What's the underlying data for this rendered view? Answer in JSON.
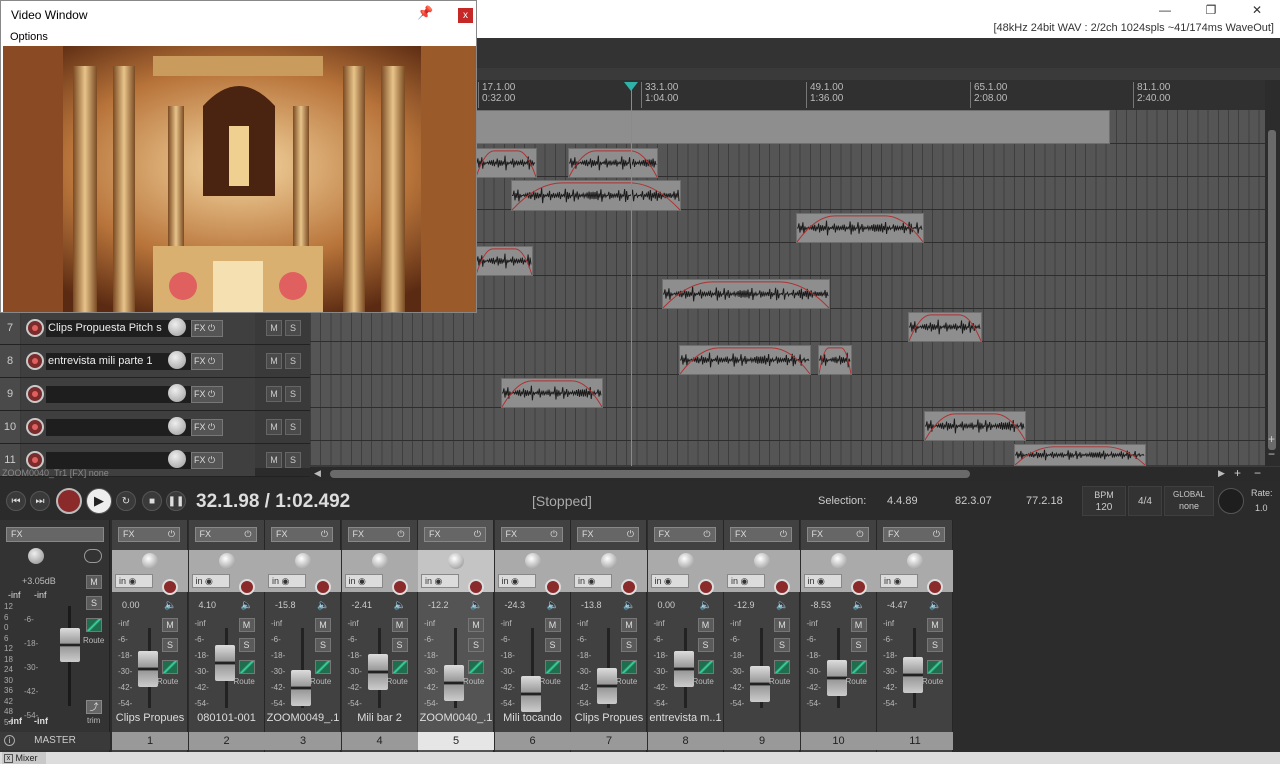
{
  "window": {
    "status_info": "[48kHz 24bit WAV : 2/2ch 1024spls ~41/174ms WaveOut]"
  },
  "video_window": {
    "title": "Video Window",
    "menu": "Options",
    "close": "x"
  },
  "ruler": [
    {
      "bar": "17.1.00",
      "time": "0:32.00"
    },
    {
      "bar": "33.1.00",
      "time": "1:04.00"
    },
    {
      "bar": "49.1.00",
      "time": "1:36.00"
    },
    {
      "bar": "65.1.00",
      "time": "2:08.00"
    },
    {
      "bar": "81.1.00",
      "time": "2:40.00"
    }
  ],
  "tracks": [
    {
      "num": "7",
      "name": "Clips   Propuesta   Pitch s"
    },
    {
      "num": "8",
      "name": "entrevista mili parte 1"
    },
    {
      "num": "9",
      "name": ""
    },
    {
      "num": "10",
      "name": ""
    },
    {
      "num": "11",
      "name": ""
    }
  ],
  "track_controls": {
    "fx": "FX",
    "mute": "M",
    "solo": "S"
  },
  "selected_item_info": "ZOOM0040_Tr1 [FX] none",
  "transport": {
    "timecode": "32.1.98 / 1:02.492",
    "state": "[Stopped]",
    "selection_label": "Selection:",
    "selection_start": "4.4.89",
    "selection_end": "82.3.07",
    "selection_length": "77.2.18",
    "bpm_label": "BPM",
    "bpm": "120",
    "time_sig": "4/4",
    "global_label": "GLOBAL",
    "global_value": "none",
    "rate_label": "Rate:",
    "rate": "1.0"
  },
  "master": {
    "gain": "+3.05dB",
    "peak_l": "-inf",
    "peak_r": "-inf",
    "scale_left": [
      "12",
      "6",
      "0",
      "6",
      "12",
      "18",
      "24",
      "30",
      "36",
      "42",
      "48",
      "54"
    ],
    "scale_mid": [
      "-6-",
      "-18-",
      "-30-",
      "-42-",
      "-54-"
    ],
    "mute": "M",
    "solo": "S",
    "route": "Route",
    "trim": "trim",
    "bottom_l": "-inf",
    "bottom_r": "-inf",
    "label": "MASTER"
  },
  "mixer_common": {
    "fx": "FX",
    "in": "in",
    "mute": "M",
    "solo": "S",
    "route": "Route",
    "scale": [
      "-inf",
      "-6-",
      "-18-",
      "-30-",
      "-42-",
      "-54-"
    ]
  },
  "mixer_strips": [
    {
      "num": "1",
      "name": "Clips   Propues",
      "vol": "0.00",
      "fader": 0.62
    },
    {
      "num": "2",
      "name": "080101-001",
      "vol": "4.10",
      "fader": 0.72
    },
    {
      "num": "3",
      "name": "ZOOM0049_.1",
      "vol": "-15.8",
      "fader": 0.3
    },
    {
      "num": "4",
      "name": "Mili bar 2",
      "vol": "-2.41",
      "fader": 0.56
    },
    {
      "num": "5",
      "name": "ZOOM0040_.1",
      "vol": "-12.2",
      "fader": 0.38
    },
    {
      "num": "6",
      "name": "Mili tocando",
      "vol": "-24.3",
      "fader": 0.2
    },
    {
      "num": "7",
      "name": "Clips   Propues",
      "vol": "-13.8",
      "fader": 0.34
    },
    {
      "num": "8",
      "name": "entrevista m..1",
      "vol": "0.00",
      "fader": 0.62
    },
    {
      "num": "9",
      "name": "",
      "vol": "-12.9",
      "fader": 0.36
    },
    {
      "num": "10",
      "name": "",
      "vol": "-8.53",
      "fader": 0.46
    },
    {
      "num": "11",
      "name": "",
      "vol": "-4.47",
      "fader": 0.52
    }
  ],
  "selected_strip": "5",
  "bottom": {
    "mixer_tab": "Mixer",
    "close_x": "x"
  }
}
